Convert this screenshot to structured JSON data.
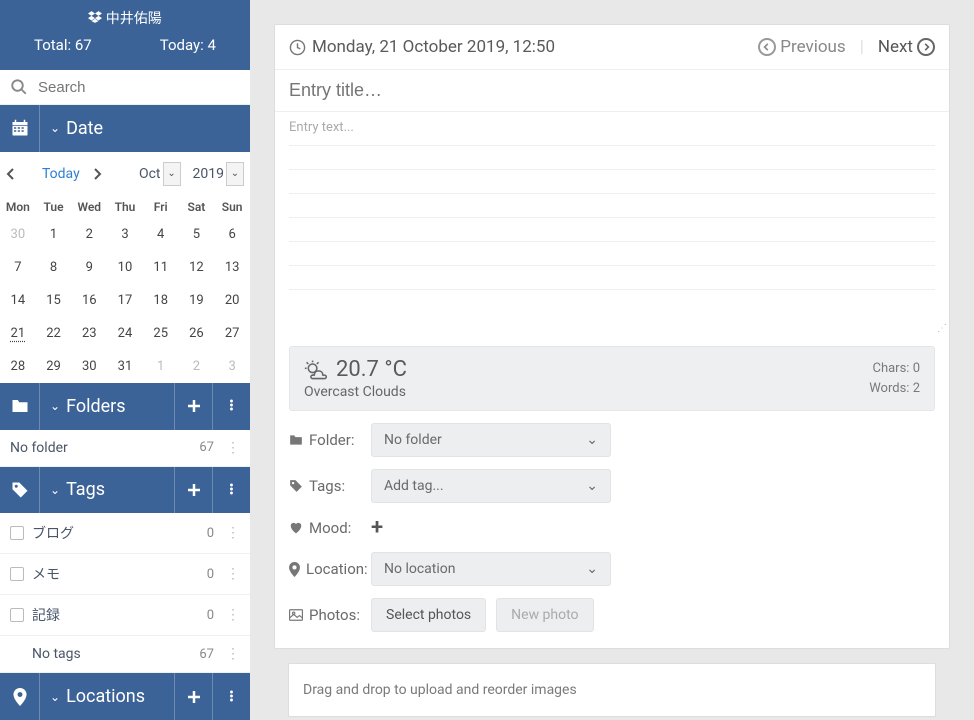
{
  "user": {
    "name": "中井佑陽"
  },
  "stats": {
    "total_label": "Total:",
    "total": "67",
    "today_label": "Today:",
    "today": "4"
  },
  "search": {
    "placeholder": "Search"
  },
  "sections": {
    "date": "Date",
    "folders": "Folders",
    "tags": "Tags",
    "locations": "Locations"
  },
  "calendar": {
    "today_label": "Today",
    "month": "Oct",
    "year": "2019",
    "weekdays": [
      "Mon",
      "Tue",
      "Wed",
      "Thu",
      "Fri",
      "Sat",
      "Sun"
    ],
    "days": [
      {
        "n": "30",
        "other": true
      },
      {
        "n": "1"
      },
      {
        "n": "2"
      },
      {
        "n": "3"
      },
      {
        "n": "4"
      },
      {
        "n": "5"
      },
      {
        "n": "6"
      },
      {
        "n": "7"
      },
      {
        "n": "8"
      },
      {
        "n": "9"
      },
      {
        "n": "10"
      },
      {
        "n": "11"
      },
      {
        "n": "12"
      },
      {
        "n": "13"
      },
      {
        "n": "14"
      },
      {
        "n": "15"
      },
      {
        "n": "16"
      },
      {
        "n": "17"
      },
      {
        "n": "18"
      },
      {
        "n": "19"
      },
      {
        "n": "20"
      },
      {
        "n": "21",
        "today": true
      },
      {
        "n": "22"
      },
      {
        "n": "23"
      },
      {
        "n": "24"
      },
      {
        "n": "25"
      },
      {
        "n": "26"
      },
      {
        "n": "27"
      },
      {
        "n": "28"
      },
      {
        "n": "29"
      },
      {
        "n": "30"
      },
      {
        "n": "31"
      },
      {
        "n": "1",
        "other": true
      },
      {
        "n": "2",
        "other": true
      },
      {
        "n": "3",
        "other": true
      }
    ]
  },
  "folders": {
    "no_folder": {
      "name": "No folder",
      "count": "67"
    }
  },
  "tags": {
    "items": [
      {
        "name": "ブログ",
        "count": "0"
      },
      {
        "name": "メモ",
        "count": "0"
      },
      {
        "name": "記録",
        "count": "0"
      }
    ],
    "no_tags": {
      "name": "No tags",
      "count": "67"
    }
  },
  "entry": {
    "datetime": "Monday, 21 October 2019, 12:50",
    "prev": "Previous",
    "next": "Next",
    "title_placeholder": "Entry title…",
    "body_placeholder": "Entry text..."
  },
  "weather": {
    "temp": "20.7 °C",
    "desc": "Overcast Clouds",
    "chars_label": "Chars:",
    "chars": "0",
    "words_label": "Words:",
    "words": "2"
  },
  "meta": {
    "folder_label": "Folder:",
    "folder_value": "No folder",
    "tags_label": "Tags:",
    "tags_value": "Add tag...",
    "mood_label": "Mood:",
    "location_label": "Location:",
    "location_value": "No location",
    "photos_label": "Photos:",
    "select_photos": "Select photos",
    "new_photo": "New photo"
  },
  "dropzone": "Drag and drop to upload and reorder images"
}
